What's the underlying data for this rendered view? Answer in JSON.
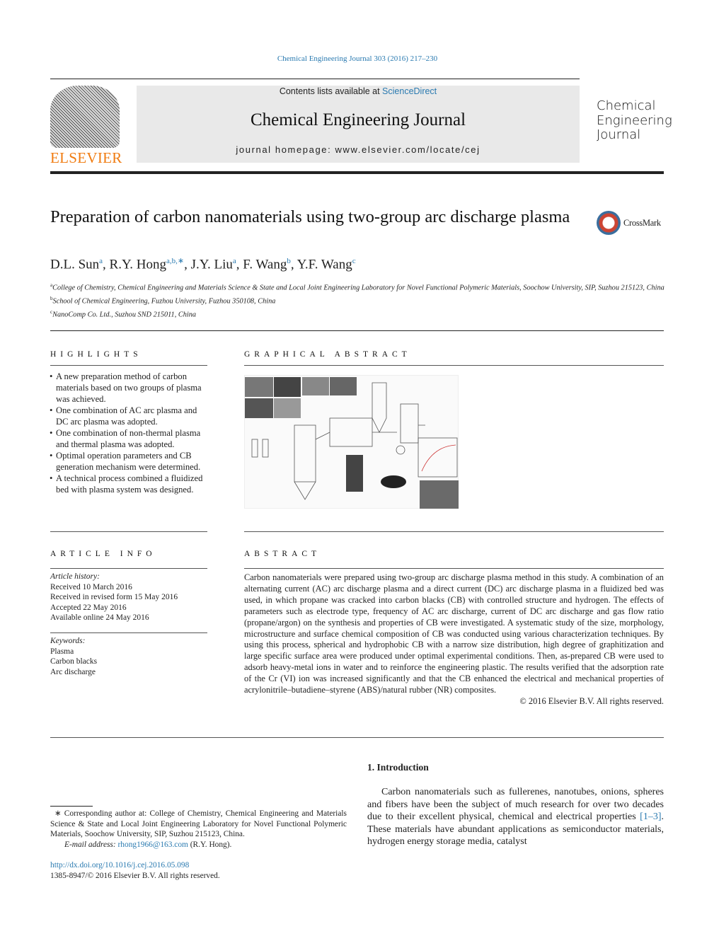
{
  "header": {
    "journal_ref": "Chemical Engineering Journal 303 (2016) 217–230",
    "contents_prefix": "Contents lists available at ",
    "contents_link": "ScienceDirect",
    "journal_title": "Chemical Engineering Journal",
    "homepage_prefix": "journal homepage: ",
    "homepage_url": "www.elsevier.com/locate/cej",
    "publisher_logo": "ELSEVIER",
    "cover_title": [
      "Chemical",
      "Engineering",
      "Journal"
    ]
  },
  "article": {
    "title": "Preparation of carbon nanomaterials using two-group arc discharge plasma",
    "crossmark": "CrossMark",
    "authors": [
      {
        "name": "D.L. Sun",
        "sup": "a"
      },
      {
        "name": "R.Y. Hong",
        "sup": "a,b,∗"
      },
      {
        "name": "J.Y. Liu",
        "sup": "a"
      },
      {
        "name": "F. Wang",
        "sup": "b"
      },
      {
        "name": "Y.F. Wang",
        "sup": "c"
      }
    ],
    "affiliations": [
      {
        "sup": "a",
        "text": "College of Chemistry, Chemical Engineering and Materials Science & State and Local Joint Engineering Laboratory for Novel Functional Polymeric Materials, Soochow University, SIP, Suzhou 215123, China"
      },
      {
        "sup": "b",
        "text": "School of Chemical Engineering, Fuzhou University, Fuzhou 350108, China"
      },
      {
        "sup": "c",
        "text": "NanoComp Co. Ltd., Suzhou SND 215011, China"
      }
    ]
  },
  "highlights": {
    "heading": "HIGHLIGHTS",
    "items": [
      "A new preparation method of carbon materials based on two groups of plasma was achieved.",
      "One combination of AC arc plasma and DC arc plasma was adopted.",
      "One combination of non-thermal plasma and thermal plasma was adopted.",
      "Optimal operation parameters and CB generation mechanism were determined.",
      "A technical process combined a fluidized bed with plasma system was designed."
    ]
  },
  "graphical_abstract": {
    "heading": "GRAPHICAL ABSTRACT"
  },
  "article_info": {
    "heading": "ARTICLE INFO",
    "history_label": "Article history:",
    "history": [
      "Received 10 March 2016",
      "Received in revised form 15 May 2016",
      "Accepted 22 May 2016",
      "Available online 24 May 2016"
    ],
    "keywords_label": "Keywords:",
    "keywords": [
      "Plasma",
      "Carbon blacks",
      "Arc discharge"
    ]
  },
  "abstract": {
    "heading": "ABSTRACT",
    "text": "Carbon nanomaterials were prepared using two-group arc discharge plasma method in this study. A com­bination of an alternating current (AC) arc discharge plasma and a direct current (DC) arc discharge plasma in a fluidized bed was used, in which propane was cracked into carbon blacks (CB) with controlled structure and hydrogen. The effects of parameters such as electrode type, frequency of AC arc discharge, current of DC arc discharge and gas flow ratio (propane/argon) on the synthesis and properties of CB were investigated. A systematic study of the size, morphology, microstructure and surface chemical composi­tion of CB was conducted using various characterization techniques. By using this process, spherical and hydrophobic CB with a narrow size distribution, high degree of graphitization and large specific surface area were produced under optimal experimental conditions. Then, as-prepared CB were used to adsorb heavy-metal ions in water and to reinforce the engineering plastic. The results verified that the adsorp­tion rate of the Cr (VI) ion was increased significantly and that the CB enhanced the electrical and mechanical properties of acrylonitrile–butadiene–styrene (ABS)/natural rubber (NR) composites.",
    "copyright": "© 2016 Elsevier B.V. All rights reserved."
  },
  "introduction": {
    "heading": "1. Introduction",
    "text_before": "Carbon nanomaterials such as fullerenes, nanotubes, onions, spheres and fibers have been the subject of much research for over two decades due to their excellent physical, chemical and electrical properties ",
    "citation": "[1–3]",
    "text_after": ". These materials have abundant applications as semiconductor materials, hydrogen energy storage media, catalyst"
  },
  "footnote": {
    "text": "∗ Corresponding author at: College of Chemistry, Chemical Engineering and Materials Science & State and Local Joint Engineering Laboratory for Novel Functional Polymeric Materials, Soochow University, SIP, Suzhou 215123, China.",
    "email_label": "E-mail address: ",
    "email": "rhong1966@163.com",
    "email_suffix": " (R.Y. Hong).",
    "doi": "http://dx.doi.org/10.1016/j.cej.2016.05.098",
    "issn": "1385-8947/© 2016 Elsevier B.V. All rights reserved."
  }
}
